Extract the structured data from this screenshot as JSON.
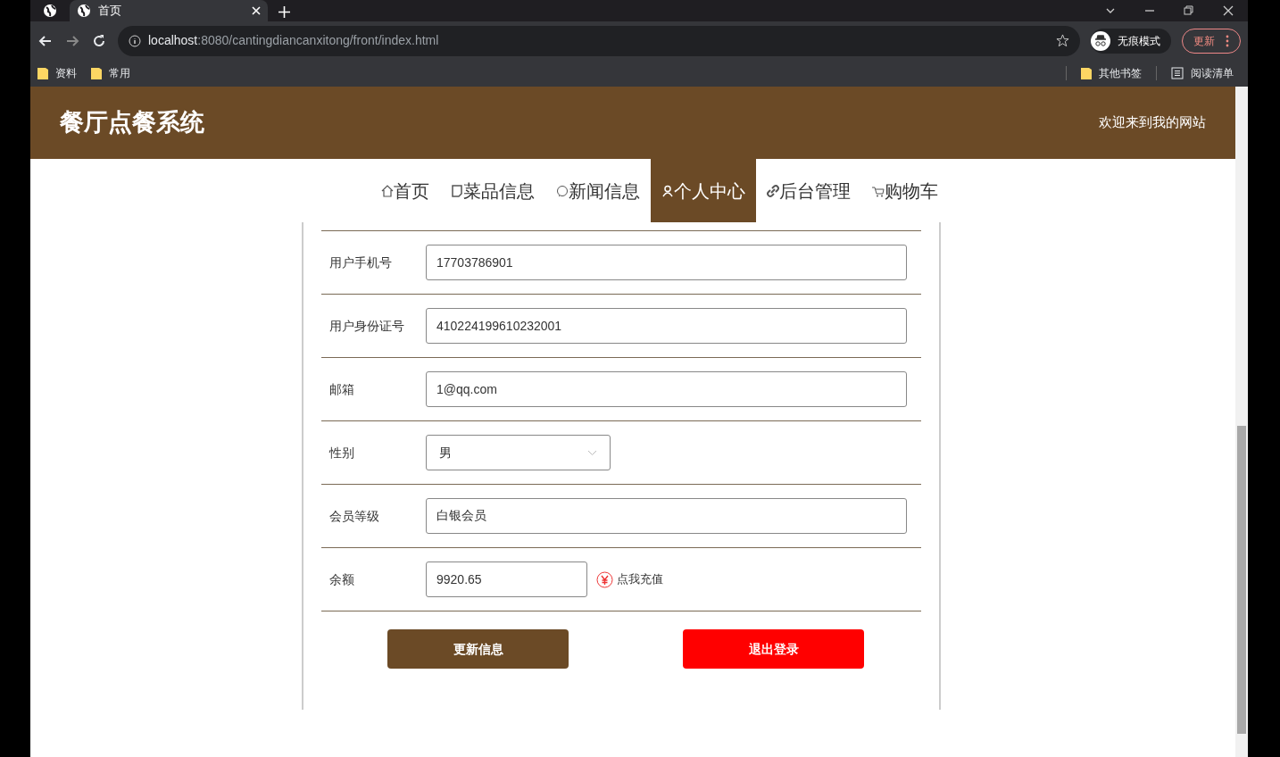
{
  "browser": {
    "tab": {
      "title": "首页"
    },
    "url": {
      "host": "localhost",
      "rest": ":8080/cantingdiancanxitong/front/index.html"
    },
    "incognito": "无痕模式",
    "update": "更新",
    "bookmarks": [
      "资料",
      "常用"
    ],
    "bookmarks_right": [
      "其他书签",
      "阅读清单"
    ]
  },
  "header": {
    "title": "餐厅点餐系统",
    "welcome": "欢迎来到我的网站"
  },
  "nav": [
    {
      "label": "首页",
      "selected": false
    },
    {
      "label": "菜品信息",
      "selected": false
    },
    {
      "label": "新闻信息",
      "selected": false
    },
    {
      "label": "个人中心",
      "selected": true
    },
    {
      "label": "后台管理",
      "selected": false
    },
    {
      "label": "购物车",
      "selected": false
    }
  ],
  "form": {
    "fields": [
      {
        "kind": "input",
        "label": "用户手机号",
        "value": "17703786901"
      },
      {
        "kind": "input",
        "label": "用户身份证号",
        "value": "410224199610232001"
      },
      {
        "kind": "input",
        "label": "邮箱",
        "value": "1@qq.com"
      },
      {
        "kind": "select",
        "label": "性别",
        "value": "男"
      },
      {
        "kind": "input",
        "label": "会员等级",
        "value": "白银会员"
      },
      {
        "kind": "balance",
        "label": "余额",
        "value": "9920.65",
        "link": "点我充值"
      }
    ],
    "buttons": [
      {
        "kind": "primary",
        "label": "更新信息"
      },
      {
        "kind": "danger",
        "label": "退出登录"
      }
    ]
  }
}
